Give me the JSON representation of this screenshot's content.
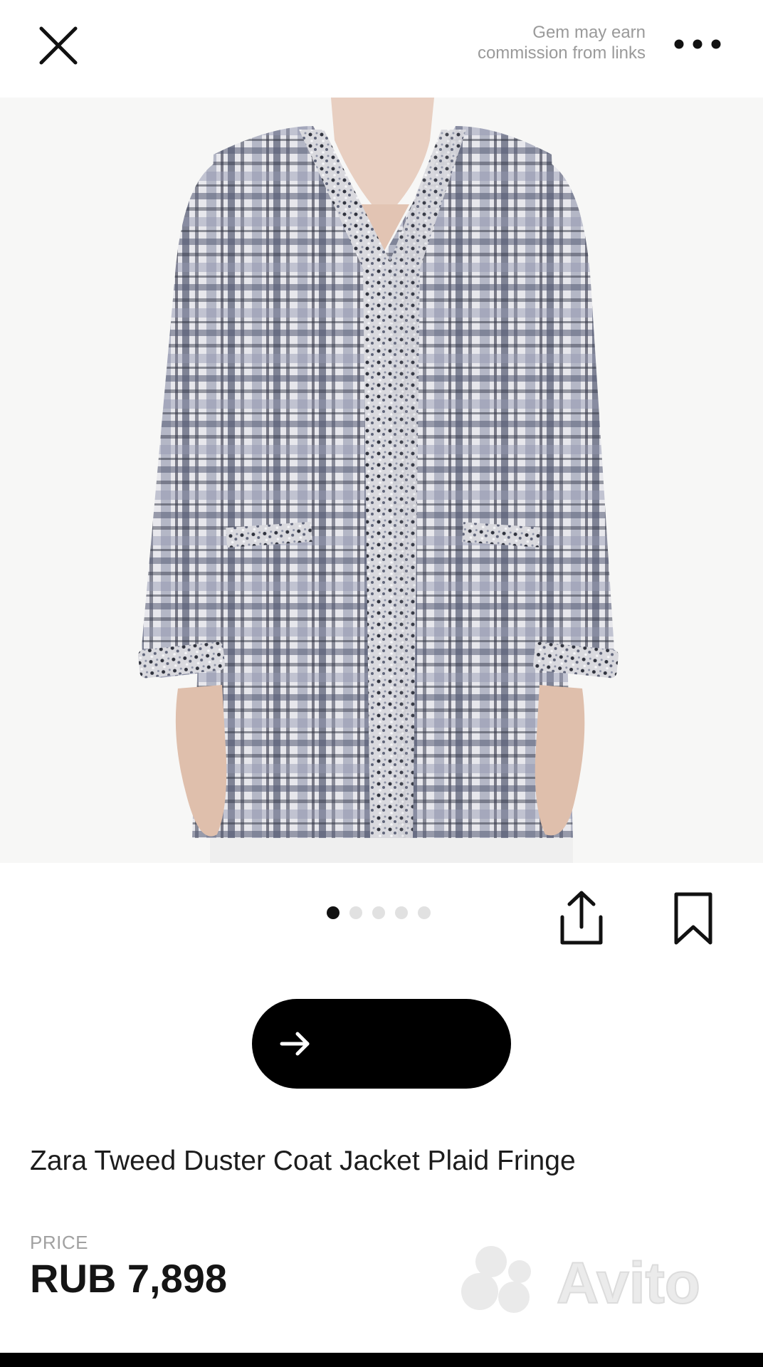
{
  "header": {
    "close_icon": "close-icon",
    "commission_line1": "Gem may earn",
    "commission_line2": "commission from links",
    "more_icon": "more-dots-icon"
  },
  "product": {
    "image_description_icon": "product-photo",
    "carousel": {
      "count": 5,
      "active_index": 0
    },
    "actions": {
      "share_icon": "share-icon",
      "bookmark_icon": "bookmark-icon"
    },
    "cta": {
      "icon": "arrow-right-icon",
      "label": ""
    },
    "title": "Zara Tweed Duster Coat Jacket Plaid Fringe",
    "price_label": "PRICE",
    "price": "RUB 7,898"
  },
  "watermark": {
    "text": "Avito"
  },
  "colors": {
    "background": "#ffffff",
    "text_primary": "#1c1c1c",
    "text_muted": "#9a9a9a",
    "cta_background": "#000000",
    "dot_inactive": "#e1e1e1",
    "dot_active": "#111111"
  }
}
